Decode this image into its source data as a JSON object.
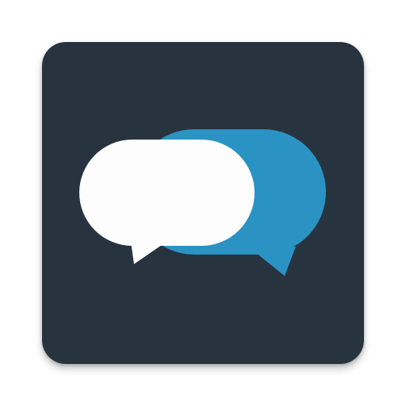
{
  "app_icon": {
    "icon": "chat-bubbles-icon",
    "colors": {
      "tile_background": "#283340",
      "front_bubble": "#fdfdfd",
      "back_bubble": "#2a93c3"
    }
  }
}
